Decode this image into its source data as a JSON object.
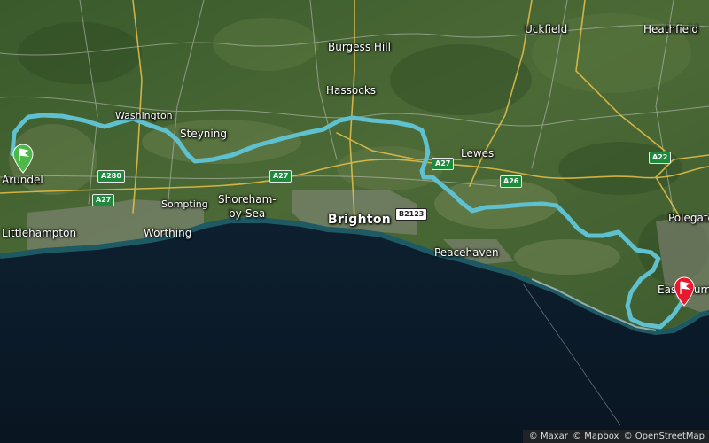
{
  "map": {
    "places": [
      {
        "id": "uckfield",
        "name": "Uckfield"
      },
      {
        "id": "heathfield",
        "name": "Heathfield"
      },
      {
        "id": "burgess-hill",
        "name": "Burgess Hill"
      },
      {
        "id": "hassocks",
        "name": "Hassocks"
      },
      {
        "id": "washington",
        "name": "Washington"
      },
      {
        "id": "steyning",
        "name": "Steyning"
      },
      {
        "id": "arundel",
        "name": "Arundel"
      },
      {
        "id": "lewes",
        "name": "Lewes"
      },
      {
        "id": "littlehampton",
        "name": "Littlehampton"
      },
      {
        "id": "sompting",
        "name": "Sompting"
      },
      {
        "id": "shoreham",
        "name": "Shoreham-"
      },
      {
        "id": "shoreham2",
        "name": "by-Sea"
      },
      {
        "id": "worthing",
        "name": "Worthing"
      },
      {
        "id": "brighton",
        "name": "Brighton"
      },
      {
        "id": "peacehaven",
        "name": "Peacehaven"
      },
      {
        "id": "polegate",
        "name": "Polegate"
      },
      {
        "id": "eastbourne",
        "name": "Eastbourne"
      }
    ],
    "road_shields": [
      {
        "id": "a280",
        "label": "A280",
        "style": "green"
      },
      {
        "id": "a27-west",
        "label": "A27",
        "style": "green"
      },
      {
        "id": "a27-mid",
        "label": "A27",
        "style": "green"
      },
      {
        "id": "a27-lewes",
        "label": "A27",
        "style": "green"
      },
      {
        "id": "a26",
        "label": "A26",
        "style": "green"
      },
      {
        "id": "a22",
        "label": "A22",
        "style": "green"
      },
      {
        "id": "b2123",
        "label": "B2123",
        "style": "white"
      }
    ],
    "route": {
      "color": "#5fc0d0",
      "start_flag_color": "#4cb848",
      "end_flag_color": "#e8192c"
    },
    "attribution": [
      "© Maxar",
      "© Mapbox",
      "© OpenStreetMap"
    ]
  }
}
